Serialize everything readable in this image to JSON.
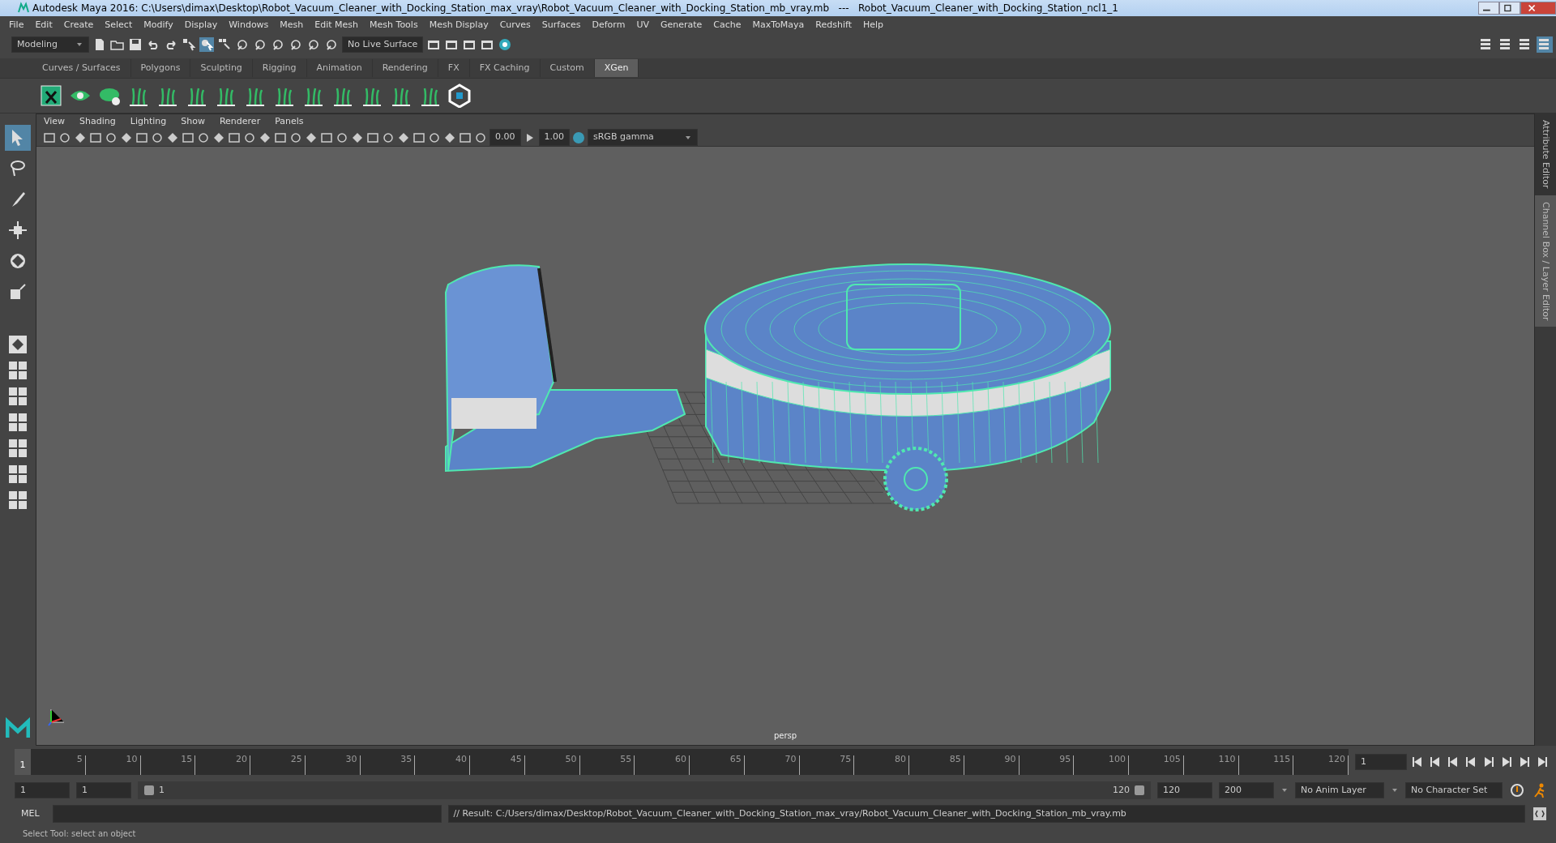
{
  "window": {
    "title": "Autodesk Maya 2016: C:\\Users\\dimax\\Desktop\\Robot_Vacuum_Cleaner_with_Docking_Station_max_vray\\Robot_Vacuum_Cleaner_with_Docking_Station_mb_vray.mb   ---   Robot_Vacuum_Cleaner_with_Docking_Station_ncl1_1"
  },
  "menu_bar": [
    "File",
    "Edit",
    "Create",
    "Select",
    "Modify",
    "Display",
    "Windows",
    "Mesh",
    "Edit Mesh",
    "Mesh Tools",
    "Mesh Display",
    "Curves",
    "Surfaces",
    "Deform",
    "UV",
    "Generate",
    "Cache",
    "MaxToMaya",
    "Redshift",
    "Help"
  ],
  "status_line": {
    "workspace": "Modeling",
    "live_surface": "No Live Surface"
  },
  "shelf": {
    "tabs": [
      {
        "label": "Curves / Surfaces",
        "selected": false
      },
      {
        "label": "Polygons",
        "selected": false
      },
      {
        "label": "Sculpting",
        "selected": false
      },
      {
        "label": "Rigging",
        "selected": false
      },
      {
        "label": "Animation",
        "selected": false
      },
      {
        "label": "Rendering",
        "selected": false
      },
      {
        "label": "FX",
        "selected": false
      },
      {
        "label": "FX Caching",
        "selected": false
      },
      {
        "label": "Custom",
        "selected": false
      },
      {
        "label": "XGen",
        "selected": true
      }
    ]
  },
  "toolbox": [
    {
      "kind": "select",
      "selected": true
    },
    {
      "kind": "lasso",
      "selected": false
    },
    {
      "kind": "paint",
      "selected": false
    },
    {
      "kind": "move",
      "selected": false
    },
    {
      "kind": "rotate",
      "selected": false
    },
    {
      "kind": "scale",
      "selected": false
    }
  ],
  "viewport": {
    "menus": [
      "View",
      "Shading",
      "Lighting",
      "Show",
      "Renderer",
      "Panels"
    ],
    "exposure": "0.00",
    "gamma": "1.00",
    "color_space": "sRGB gamma",
    "camera_label": "persp"
  },
  "side_tabs": [
    {
      "label": "Attribute Editor",
      "selected": false
    },
    {
      "label": "Channel Box / Layer Editor",
      "selected": true
    }
  ],
  "timeline": {
    "current_frame": "1",
    "ticks": [
      "5",
      "10",
      "15",
      "20",
      "25",
      "30",
      "35",
      "40",
      "45",
      "50",
      "55",
      "60",
      "65",
      "70",
      "75",
      "80",
      "85",
      "90",
      "95",
      "100",
      "105",
      "110",
      "115",
      "120"
    ],
    "frame_field": "1"
  },
  "range": {
    "level": 1,
    "start": "1",
    "playback_start": "1",
    "slider_start": "1",
    "slider_end": "120",
    "playback_end": "120",
    "end": "200",
    "anim_layer": "No Anim Layer",
    "character_set": "No Character Set"
  },
  "command_line": {
    "label": "MEL",
    "result": "// Result: C:/Users/dimax/Desktop/Robot_Vacuum_Cleaner_with_Docking_Station_max_vray/Robot_Vacuum_Cleaner_with_Docking_Station_mb_vray.mb"
  },
  "help_line": "Select Tool: select an object"
}
